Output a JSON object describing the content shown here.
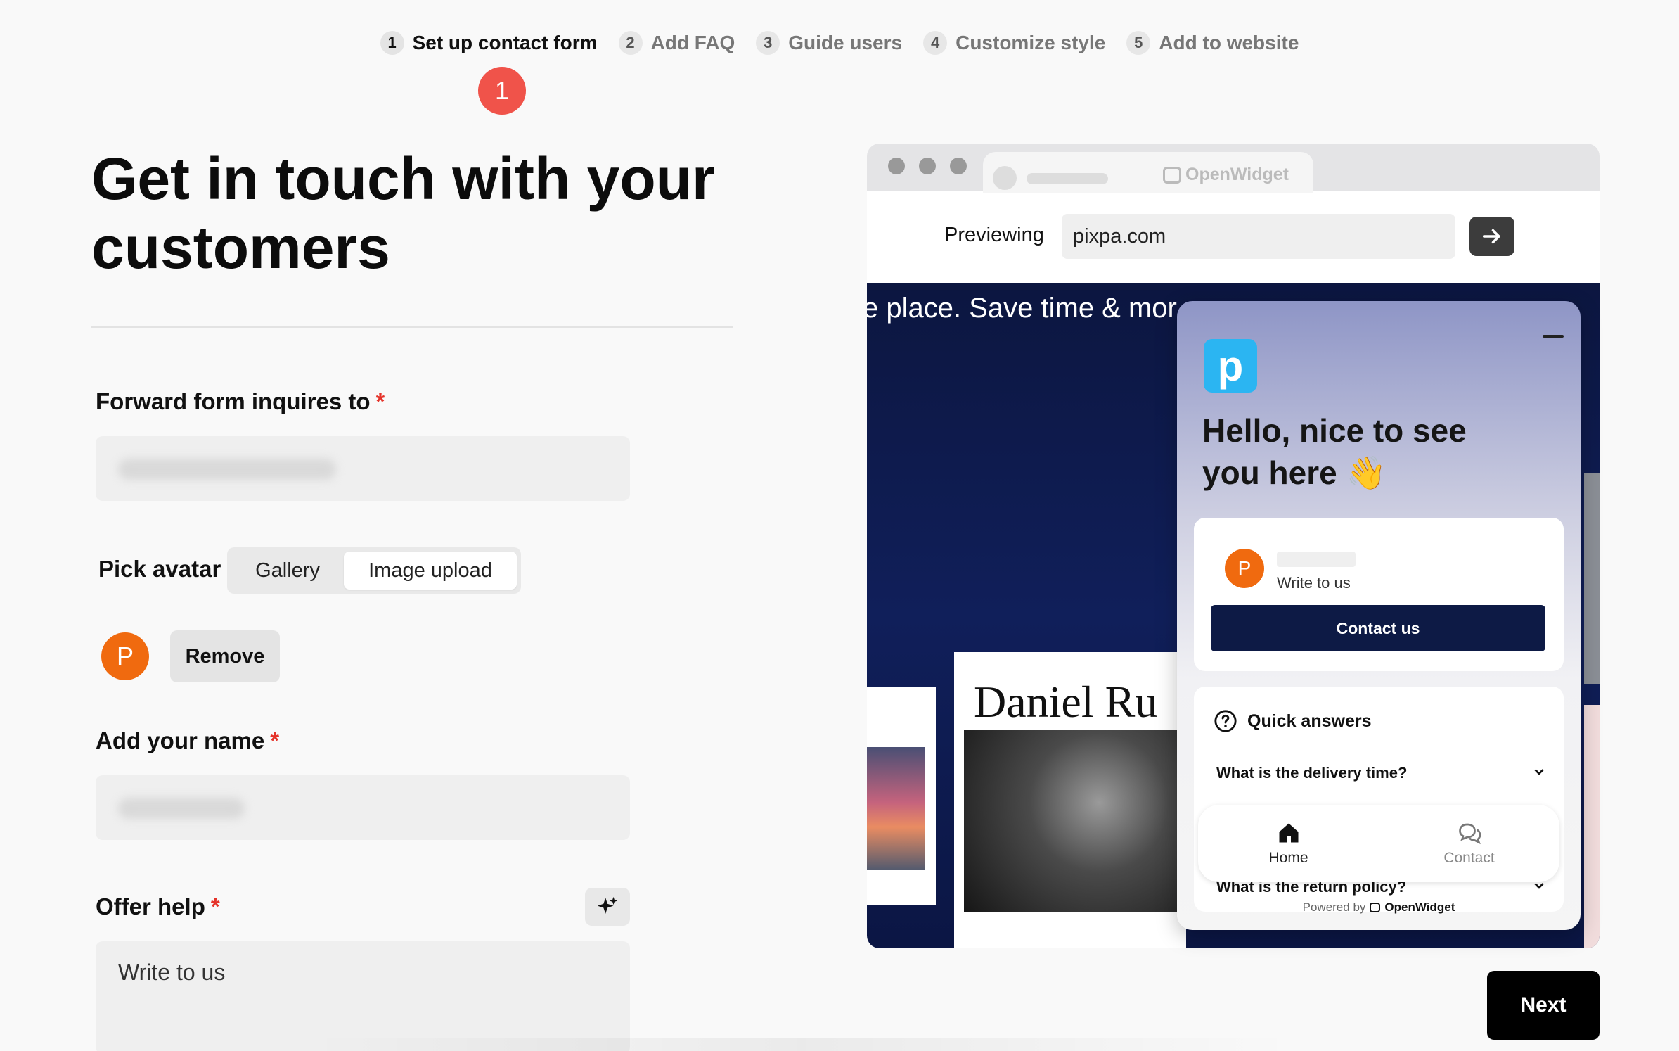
{
  "stepper": {
    "steps": [
      {
        "num": "1",
        "label": "Set up contact form"
      },
      {
        "num": "2",
        "label": "Add FAQ"
      },
      {
        "num": "3",
        "label": "Guide users"
      },
      {
        "num": "4",
        "label": "Customize style"
      },
      {
        "num": "5",
        "label": "Add to website"
      }
    ],
    "active_badge": "1"
  },
  "form": {
    "title": "Get in touch with your customers",
    "forward_label": "Forward form inquires to",
    "required_mark": "*",
    "avatar_label": "Pick avatar",
    "avatar_tabs": [
      "Gallery",
      "Image upload"
    ],
    "avatar_tab_selected": "Image upload",
    "avatar_letter": "P",
    "remove_label": "Remove",
    "name_label": "Add your name",
    "offer_label": "Offer help",
    "offer_value": "Write to us"
  },
  "preview": {
    "browser_brand": "OpenWidget",
    "previewing_label": "Previewing",
    "url": "pixpa.com",
    "site_headline": "e place. Save time & mor",
    "site_card_name": "Daniel Ru"
  },
  "widget": {
    "logo_letter": "p",
    "greeting": "Hello, nice to see you here 👋",
    "agent_letter": "P",
    "write_to_us": "Write to us",
    "contact_button": "Contact us",
    "quick_answers_title": "Quick answers",
    "faq": [
      "What is the delivery time?",
      "What is the return policy?"
    ],
    "nav": [
      "Home",
      "Contact"
    ],
    "powered_by": "Powered by",
    "powered_brand": "OpenWidget"
  },
  "actions": {
    "next_label": "Next"
  },
  "colors": {
    "accent_red": "#f0534a",
    "avatar_orange": "#f06a0f",
    "navy": "#0d1a45"
  }
}
